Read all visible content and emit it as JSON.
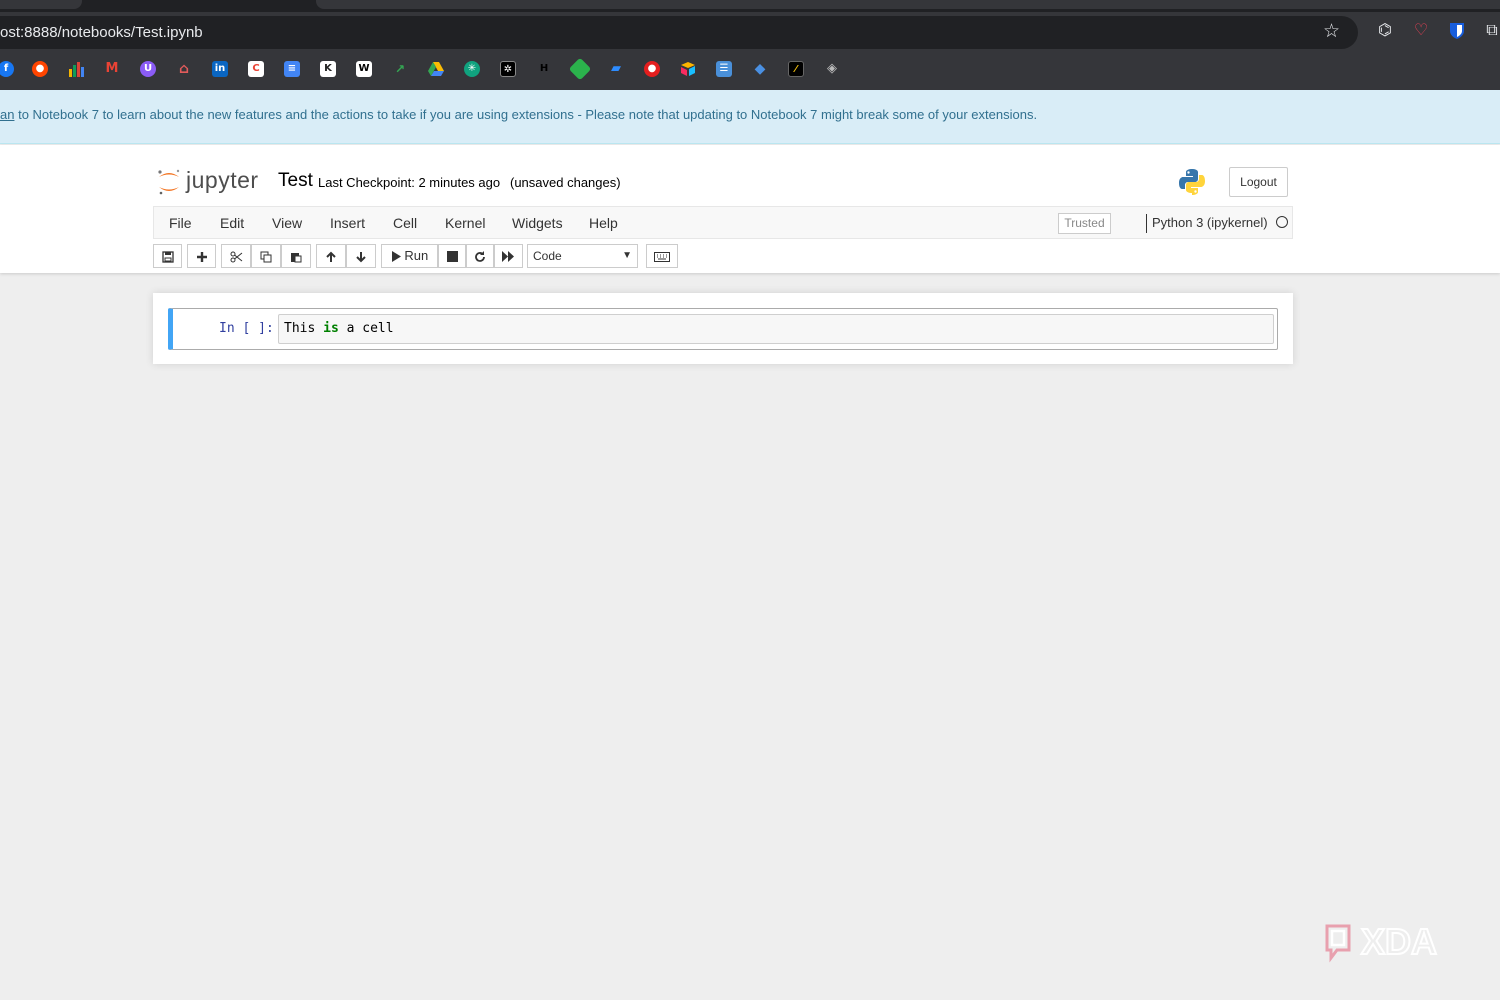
{
  "browser": {
    "url": "ost:8888/notebooks/Test.ipynb",
    "bookmark_icons": [
      "facebook-icon",
      "reddit-icon",
      "chart-icon",
      "gmail-icon",
      "proton-icon",
      "store-icon",
      "linkedin-icon",
      "google-calendar-icon",
      "google-docs-icon",
      "kb-icon",
      "wikipedia-icon",
      "arrow-icon",
      "google-drive-icon",
      "chatgpt-icon",
      "bug-icon",
      "h-icon",
      "feedly-icon",
      "chat-icon",
      "red-app-icon",
      "airtable-icon",
      "tasks-icon",
      "paint-icon",
      "terminal-icon",
      "layers-icon"
    ],
    "extension_icons": [
      "spy-icon",
      "pocket-icon",
      "bitwarden-icon",
      "puzzle-icon"
    ]
  },
  "notice": {
    "link_text": "an",
    "text": " to Notebook 7 to learn about the new features and the actions to take if you are using extensions - Please note that updating to Notebook 7 might break some of your extensions."
  },
  "header": {
    "logo_text": "jupyter",
    "notebook_name": "Test",
    "checkpoint": "Last Checkpoint: 2 minutes ago",
    "unsaved": "(unsaved changes)",
    "logout": "Logout"
  },
  "menubar": {
    "items": [
      "File",
      "Edit",
      "View",
      "Insert",
      "Cell",
      "Kernel",
      "Widgets",
      "Help"
    ],
    "trusted": "Trusted",
    "kernel": "Python 3 (ipykernel)"
  },
  "toolbar": {
    "run_label": "Run",
    "cell_type": "Code",
    "icons": [
      "save-icon",
      "plus-icon",
      "cut-icon",
      "copy-icon",
      "paste-icon",
      "arrow-up-icon",
      "arrow-down-icon",
      "play-icon",
      "stop-icon",
      "restart-icon",
      "fast-forward-icon",
      "keyboard-icon"
    ]
  },
  "cell": {
    "prompt": "In [ ]:",
    "code_pre": "This ",
    "code_kw": "is",
    "code_post": " a cell"
  },
  "watermark": {
    "text": "XDA"
  },
  "colors": {
    "cell_accent": "#42a5f5",
    "jupyter_orange": "#f37726",
    "notice_bg": "#d9edf7",
    "prompt_blue": "#303f9f",
    "keyword_green": "#008000"
  }
}
